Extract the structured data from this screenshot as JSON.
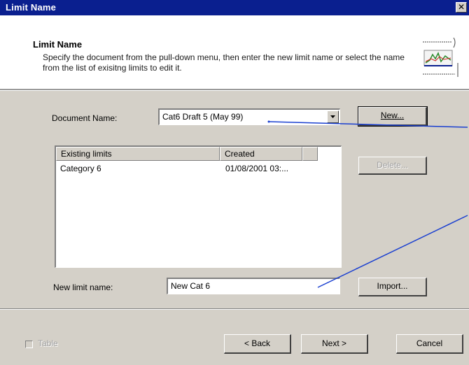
{
  "window": {
    "title": "Limit Name",
    "close_glyph": "✕"
  },
  "header": {
    "title": "Limit Name",
    "description": "Specify the document from the pull-down menu, then enter the new limit name or select the name from the list of exisitng limits to edit it."
  },
  "document": {
    "label": "Document Name:",
    "selected": "Cat6 Draft 5 (May 99)",
    "new_button": "New..."
  },
  "limits": {
    "columns": [
      "Existing limits",
      "Created"
    ],
    "rows": [
      {
        "name": "Category 6",
        "created": "01/08/2001 03:..."
      }
    ],
    "delete_button": "Delete..."
  },
  "new_limit": {
    "label": "New limit name:",
    "value": "New Cat 6",
    "import_button": "Import..."
  },
  "footer": {
    "checkbox_label": "Table",
    "back_button": "< Back",
    "next_button": "Next >",
    "cancel_button": "Cancel"
  },
  "colors": {
    "titlebar": "#0a1f8f",
    "dialog": "#d4d0c8",
    "callout": "#1a3fd0"
  }
}
